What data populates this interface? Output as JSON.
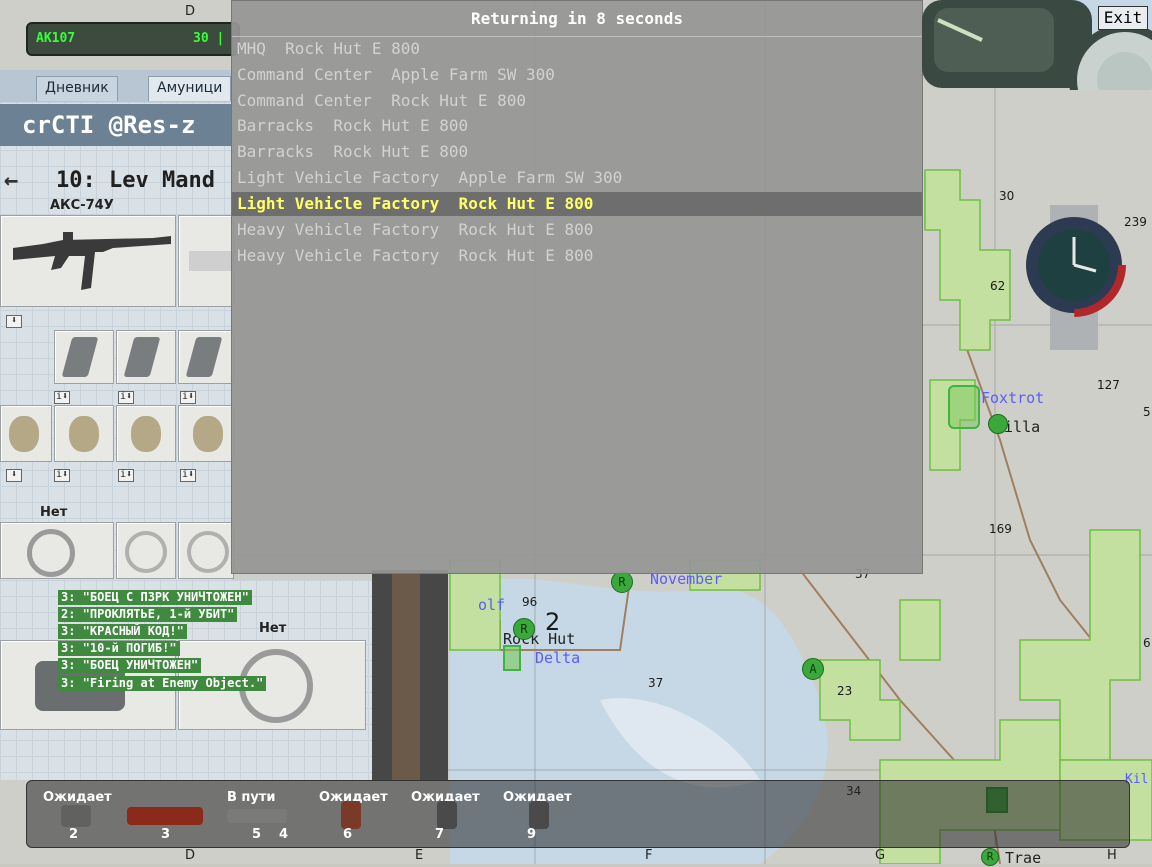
{
  "weapon_bar": {
    "weapon": "AK107",
    "ammo": "30 |"
  },
  "diary": {
    "tabs": [
      "Дневник",
      "Амуници"
    ],
    "server_title": "crCTI @Res-z",
    "back_arrow": "arrow-left-icon",
    "unit_title": "10: Lev Mand",
    "primary_weapon_name": "АКС-74У",
    "sidearm_label": "Нет",
    "secondary_label": "Нет"
  },
  "dialog": {
    "title": "Returning in 8 seconds",
    "items": [
      "MHQ  Rock Hut E 800",
      "Command Center  Apple Farm SW 300",
      "Command Center  Rock Hut E 800",
      "Barracks  Rock Hut E 800",
      "Barracks  Rock Hut E 800",
      "Light Vehicle Factory  Apple Farm SW 300",
      "Light Vehicle Factory  Rock Hut E 800",
      "Heavy Vehicle Factory  Rock Hut E 800",
      "Heavy Vehicle Factory  Rock Hut E 800"
    ],
    "selected_index": 6
  },
  "exit_button": "Exit",
  "chat": [
    "3: \"БОЕЦ С ПЗРК УНИЧТОЖЕН\"",
    "2: \"ПРОКЛЯТЬЕ, 1-й УБИТ\"",
    "3: \"КРАСНЫЙ КОД!\"",
    "3: \"10-й ПОГИБ!\"",
    "3: \"БОЕЦ УНИЧТОЖЕН\"",
    "3: \"Firing at Enemy Object.\""
  ],
  "map": {
    "grid_letters_top": [
      "D"
    ],
    "grid_letters_bottom": [
      "D",
      "E",
      "F",
      "G",
      "H"
    ],
    "numbers": [
      "30",
      "239",
      "62",
      "127",
      "5",
      "169",
      "37",
      "96",
      "2",
      "37",
      "23",
      "34",
      "6"
    ],
    "labels": {
      "foxtrot": "Foxtrot",
      "villa": "Villa",
      "november": "November",
      "golf": "olf",
      "rock_hut": "Rock Hut",
      "delta": "Delta",
      "trae": "Trae",
      "kil": "Kil"
    },
    "markers": [
      "R",
      "R",
      "A",
      "R"
    ]
  },
  "team_bar": {
    "statuses": [
      "Ожидает",
      "В пути",
      "Ожидает",
      "Ожидает",
      "Ожидает"
    ],
    "unit_numbers": [
      "2",
      "3",
      "5",
      "4",
      "6",
      "7",
      "9"
    ]
  },
  "colors": {
    "dialog_bg": "#969696",
    "selected_text": "#ffff66",
    "chat_bg": "#3f8a3f",
    "weapon_text": "#37ff37"
  }
}
